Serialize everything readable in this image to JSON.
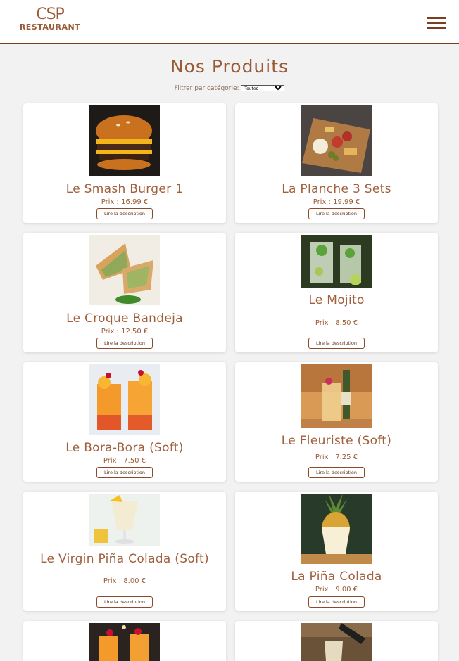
{
  "header": {
    "logo_main": "CSP",
    "logo_sub": "RESTAURANT"
  },
  "page": {
    "title": "Nos Produits",
    "filter_label": "Filtrer par catégorie:",
    "filter_selected": "Toutes"
  },
  "products": [
    {
      "name": "Le Smash Burger 1",
      "price_label": "Prix : 16.99 €",
      "button": "Lire la description",
      "image": "burger"
    },
    {
      "name": "La Planche 3 Sets",
      "price_label": "Prix : 19.99 €",
      "button": "Lire la description",
      "image": "charcuterie-board"
    },
    {
      "name": "Le Croque Bandeja",
      "price_label": "Prix : 12.50 €",
      "button": "Lire la description",
      "image": "grilled-sandwich"
    },
    {
      "name": "Le Mojito",
      "price_label": "Prix : 8.50 €",
      "button": "Lire la description",
      "image": "mojito"
    },
    {
      "name": "Le Bora-Bora (Soft)",
      "price_label": "Prix : 7.50 €",
      "button": "Lire la description",
      "image": "orange-cocktail"
    },
    {
      "name": "Le Fleuriste (Soft)",
      "price_label": "Prix : 7.25 €",
      "button": "Lire la description",
      "image": "soda-glass"
    },
    {
      "name": "Le Virgin Piña Colada (Soft)",
      "price_label": "Prix : 8.00 €",
      "button": "Lire la description",
      "image": "pina-colada-glass"
    },
    {
      "name": "La Piña Colada",
      "price_label": "Prix : 9.00 €",
      "button": "Lire la description",
      "image": "pineapple-cocktail"
    }
  ],
  "colors": {
    "accent": "#9a5a35",
    "background": "#f2f2f2"
  }
}
